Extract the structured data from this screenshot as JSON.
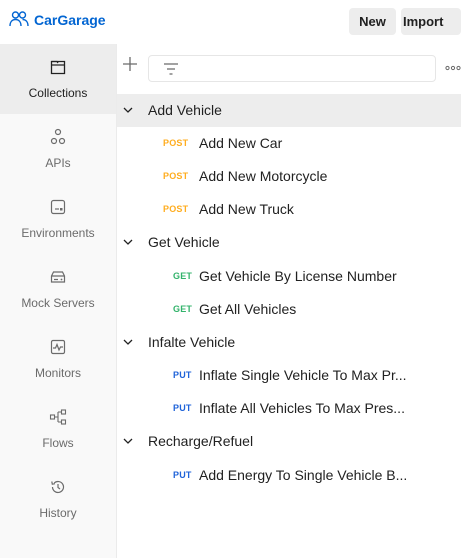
{
  "workspace": {
    "name": "CarGarage"
  },
  "header": {
    "new_label": "New",
    "import_label": "Import"
  },
  "sidebar": {
    "items": [
      {
        "label": "Collections",
        "icon": "collections-icon",
        "active": true
      },
      {
        "label": "APIs",
        "icon": "apis-icon"
      },
      {
        "label": "Environments",
        "icon": "environments-icon"
      },
      {
        "label": "Mock Servers",
        "icon": "mock-servers-icon"
      },
      {
        "label": "Monitors",
        "icon": "monitors-icon"
      },
      {
        "label": "Flows",
        "icon": "flows-icon"
      },
      {
        "label": "History",
        "icon": "history-icon"
      }
    ]
  },
  "toolbar": {
    "filter_placeholder": ""
  },
  "tree": {
    "folders": [
      {
        "name": "Add Vehicle",
        "requests": [
          {
            "method": "POST",
            "name": "Add New Car"
          },
          {
            "method": "POST",
            "name": "Add New Motorcycle"
          },
          {
            "method": "POST",
            "name": "Add New Truck"
          }
        ]
      },
      {
        "name": "Get Vehicle",
        "requests": [
          {
            "method": "GET",
            "name": "Get Vehicle By License Number"
          },
          {
            "method": "GET",
            "name": "Get All Vehicles"
          }
        ]
      },
      {
        "name": "Infalte Vehicle",
        "requests": [
          {
            "method": "PUT",
            "name": "Inflate Single Vehicle To Max Pr..."
          },
          {
            "method": "PUT",
            "name": "Inflate All Vehicles To Max Pres..."
          }
        ]
      },
      {
        "name": "Recharge/Refuel",
        "requests": [
          {
            "method": "PUT",
            "name": "Add Energy To Single Vehicle B..."
          }
        ]
      }
    ]
  },
  "colors": {
    "post": "#ffad1f",
    "get": "#33b36b",
    "put": "#1f63d9",
    "brand": "#0265d2"
  }
}
